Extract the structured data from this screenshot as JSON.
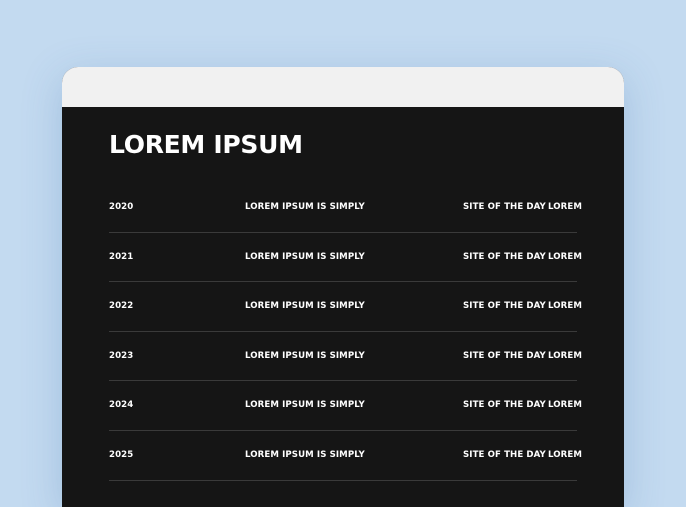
{
  "page": {
    "heading": "LOREM IPSUM"
  },
  "rows": [
    {
      "year": "2020",
      "description": "LOREM IPSUM IS SIMPLY",
      "award": "SITE OF THE DAY",
      "extra": "LOREM"
    },
    {
      "year": "2021",
      "description": "LOREM IPSUM IS SIMPLY",
      "award": "SITE OF THE DAY",
      "extra": "LOREM"
    },
    {
      "year": "2022",
      "description": "LOREM IPSUM IS SIMPLY",
      "award": "SITE OF THE DAY",
      "extra": "LOREM"
    },
    {
      "year": "2023",
      "description": "LOREM IPSUM IS SIMPLY",
      "award": "SITE OF THE DAY",
      "extra": "LOREM"
    },
    {
      "year": "2024",
      "description": "LOREM IPSUM IS SIMPLY",
      "award": "SITE OF THE DAY",
      "extra": "LOREM"
    },
    {
      "year": "2025",
      "description": "LOREM IPSUM IS SIMPLY",
      "award": "SITE OF THE DAY",
      "extra": "LOREM"
    }
  ],
  "colors": {
    "background": "#c3daf0",
    "window": "#151515",
    "titlebar": "#f1f1f1",
    "text": "#ffffff",
    "divider": "#3a3a3a"
  }
}
